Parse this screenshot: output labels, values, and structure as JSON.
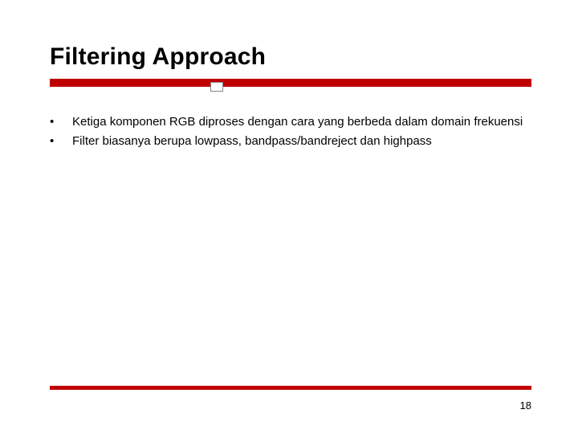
{
  "title": "Filtering Approach",
  "bullets": [
    "Ketiga komponen RGB diproses dengan cara yang berbeda dalam domain frekuensi",
    "Filter biasanya berupa lowpass, bandpass/bandreject dan highpass"
  ],
  "bullet_glyph": "•",
  "page_number": "18",
  "accent_color": "#c00000"
}
